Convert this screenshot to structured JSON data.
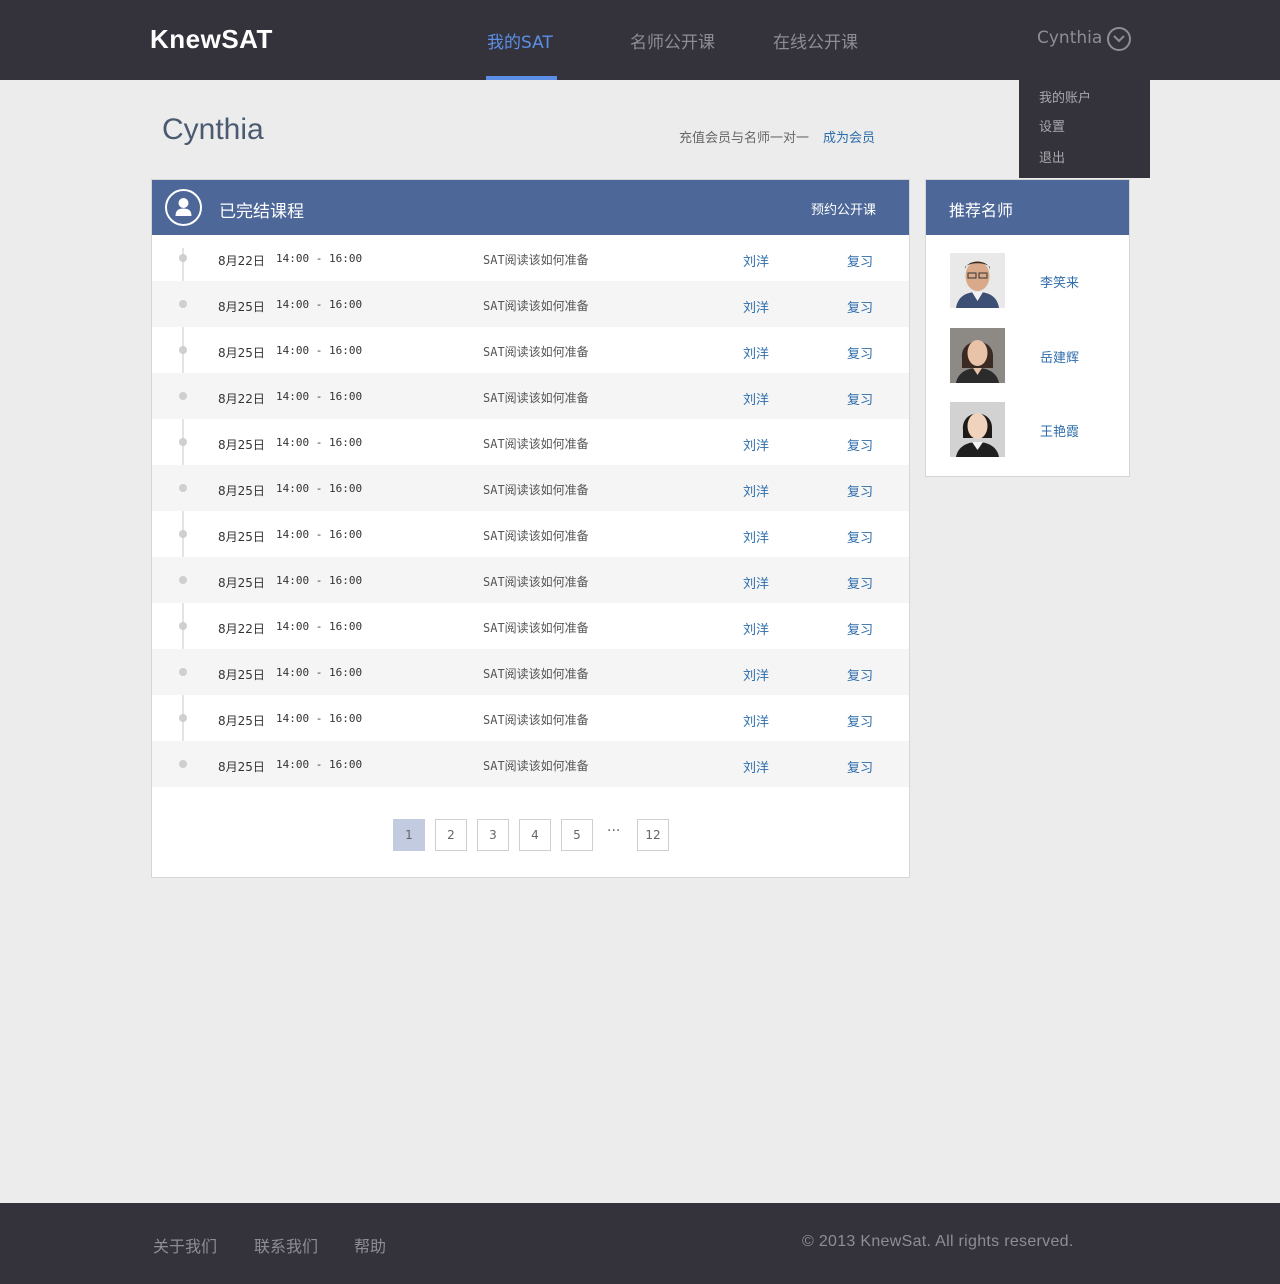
{
  "brand": {
    "logo": "KnewSAT"
  },
  "nav": {
    "items": [
      {
        "label": "我的SAT",
        "active": true
      },
      {
        "label": "名师公开课",
        "active": false
      },
      {
        "label": "在线公开课",
        "active": false
      }
    ],
    "user_name": "Cynthia",
    "user_menu_icon": "chevron-down-circle-icon"
  },
  "user_menu": {
    "items": [
      {
        "label": "我的账户"
      },
      {
        "label": "设置"
      },
      {
        "label": "退出"
      }
    ]
  },
  "header": {
    "title": "Cynthia",
    "promo_text": "充值会员与名师一对一",
    "promo_link": "成为会员"
  },
  "courses_panel": {
    "title": "已完结课程",
    "action": "预约公开课",
    "icon": "user-icon",
    "rows": [
      {
        "date": "8月22日",
        "time": "14:00 - 16:00",
        "course": "SAT阅读该如何准备",
        "teacher": "刘洋",
        "action": "复习"
      },
      {
        "date": "8月25日",
        "time": "14:00 - 16:00",
        "course": "SAT阅读该如何准备",
        "teacher": "刘洋",
        "action": "复习"
      },
      {
        "date": "8月25日",
        "time": "14:00 - 16:00",
        "course": "SAT阅读该如何准备",
        "teacher": "刘洋",
        "action": "复习"
      },
      {
        "date": "8月22日",
        "time": "14:00 - 16:00",
        "course": "SAT阅读该如何准备",
        "teacher": "刘洋",
        "action": "复习"
      },
      {
        "date": "8月25日",
        "time": "14:00 - 16:00",
        "course": "SAT阅读该如何准备",
        "teacher": "刘洋",
        "action": "复习"
      },
      {
        "date": "8月25日",
        "time": "14:00 - 16:00",
        "course": "SAT阅读该如何准备",
        "teacher": "刘洋",
        "action": "复习"
      },
      {
        "date": "8月25日",
        "time": "14:00 - 16:00",
        "course": "SAT阅读该如何准备",
        "teacher": "刘洋",
        "action": "复习"
      },
      {
        "date": "8月25日",
        "time": "14:00 - 16:00",
        "course": "SAT阅读该如何准备",
        "teacher": "刘洋",
        "action": "复习"
      },
      {
        "date": "8月22日",
        "time": "14:00 - 16:00",
        "course": "SAT阅读该如何准备",
        "teacher": "刘洋",
        "action": "复习"
      },
      {
        "date": "8月25日",
        "time": "14:00 - 16:00",
        "course": "SAT阅读该如何准备",
        "teacher": "刘洋",
        "action": "复习"
      },
      {
        "date": "8月25日",
        "time": "14:00 - 16:00",
        "course": "SAT阅读该如何准备",
        "teacher": "刘洋",
        "action": "复习"
      },
      {
        "date": "8月25日",
        "time": "14:00 - 16:00",
        "course": "SAT阅读该如何准备",
        "teacher": "刘洋",
        "action": "复习"
      }
    ],
    "pagination": {
      "pages": [
        "1",
        "2",
        "3",
        "4",
        "5"
      ],
      "ellipsis": "···",
      "last": "12",
      "current": "1"
    }
  },
  "teachers_panel": {
    "title": "推荐名师",
    "teachers": [
      {
        "name": "李笑来"
      },
      {
        "name": "岳建辉"
      },
      {
        "name": "王艳霞"
      }
    ]
  },
  "footer": {
    "links": [
      "关于我们",
      "联系我们",
      "帮助"
    ],
    "copyright": "© 2013 KnewSat. All rights reserved."
  },
  "colors": {
    "topbar": "#34333b",
    "accent": "#5b8fe6",
    "panel_header": "#4d6798",
    "link": "#2e6dab",
    "background": "#ececec"
  }
}
